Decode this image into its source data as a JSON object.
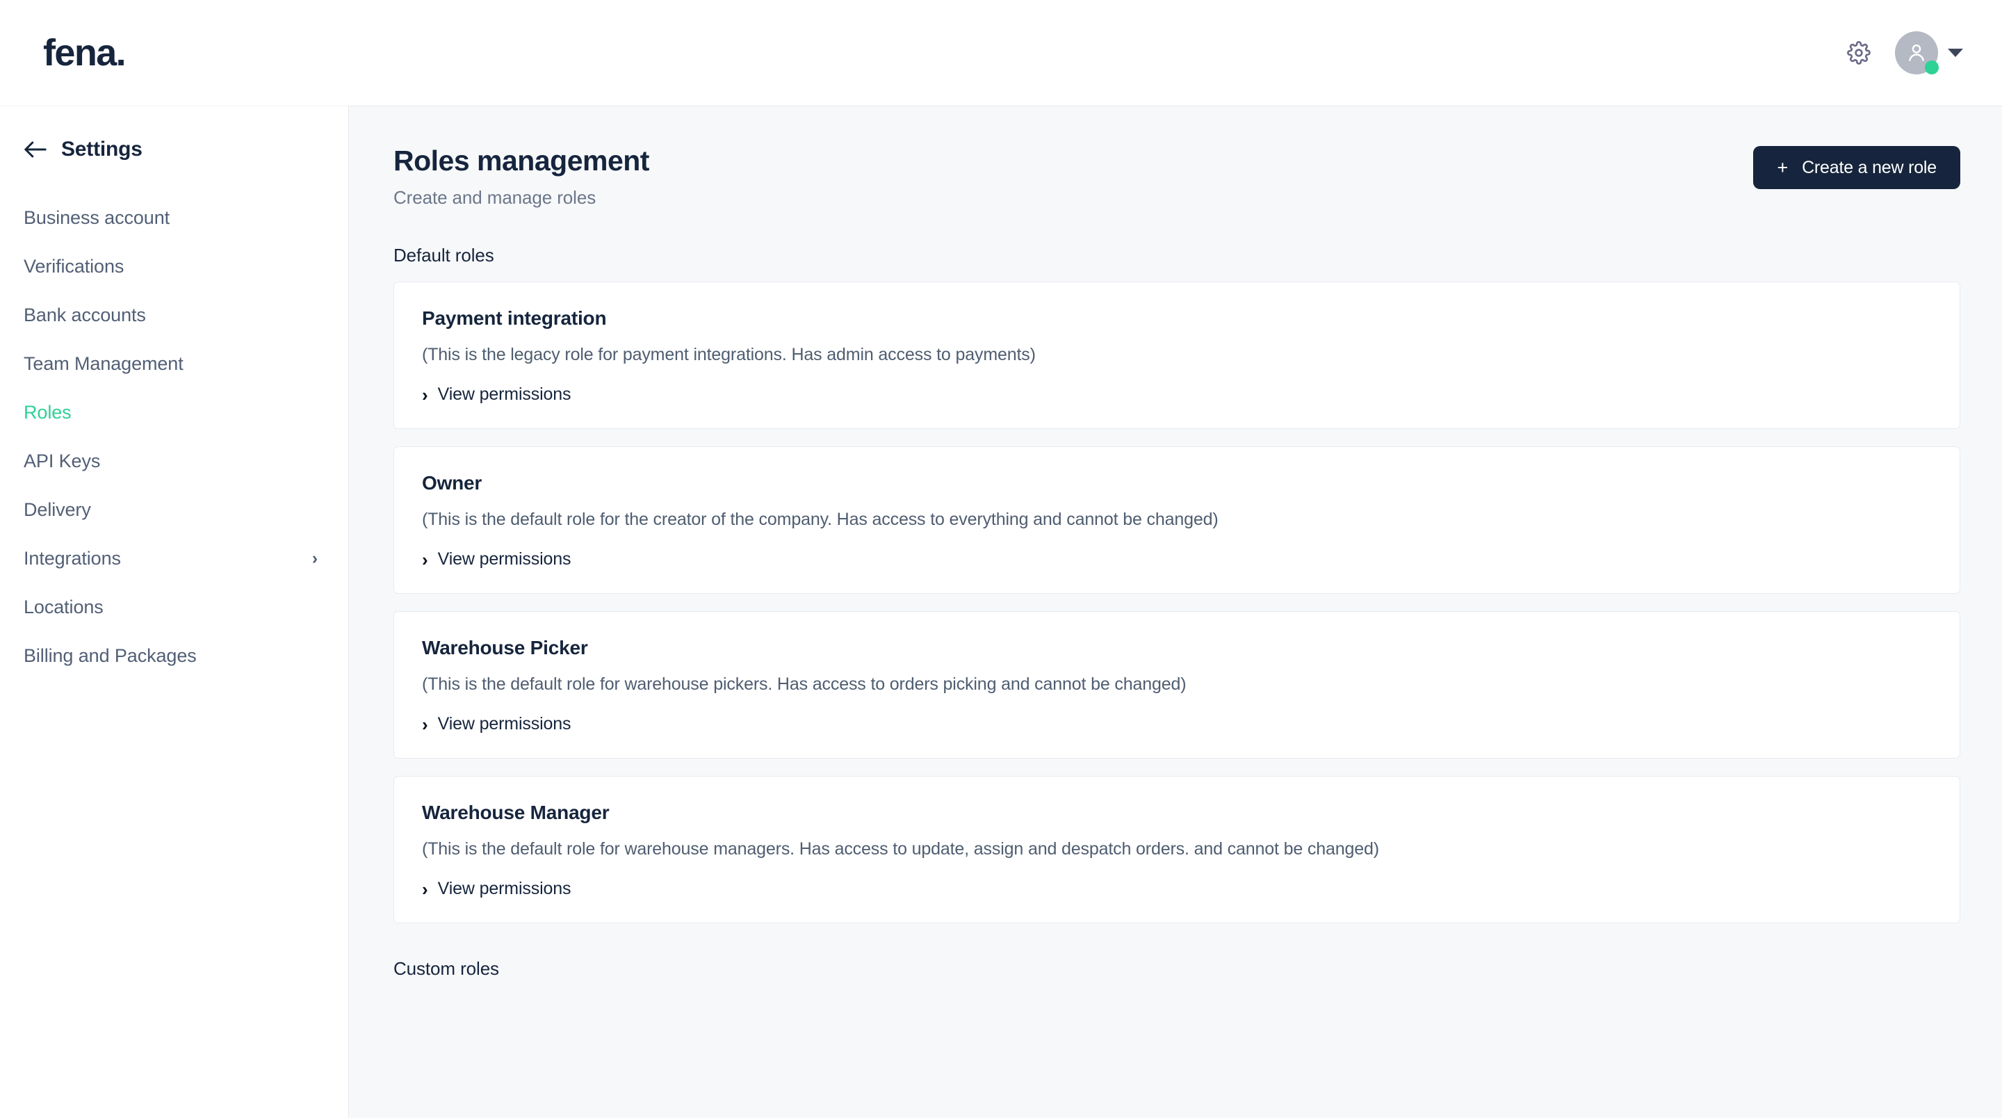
{
  "header": {
    "brand": "fena.",
    "gear_icon": "gear-icon",
    "avatar_icon": "person-icon",
    "status_color": "#2ed196",
    "caret_icon": "chevron-down-icon"
  },
  "sidebar": {
    "back_icon": "arrow-left-icon",
    "title": "Settings",
    "active_color": "#2ed196",
    "items": [
      {
        "label": "Business account",
        "active": false,
        "chevron": ""
      },
      {
        "label": "Verifications",
        "active": false,
        "chevron": ""
      },
      {
        "label": "Bank accounts",
        "active": false,
        "chevron": ""
      },
      {
        "label": "Team Management",
        "active": false,
        "chevron": ""
      },
      {
        "label": "Roles",
        "active": true,
        "chevron": ""
      },
      {
        "label": "API Keys",
        "active": false,
        "chevron": ""
      },
      {
        "label": "Delivery",
        "active": false,
        "chevron": ""
      },
      {
        "label": "Integrations",
        "active": false,
        "chevron": "›"
      },
      {
        "label": "Locations",
        "active": false,
        "chevron": ""
      },
      {
        "label": "Billing and Packages",
        "active": false,
        "chevron": ""
      }
    ]
  },
  "main": {
    "title": "Roles management",
    "subtitle": "Create and manage roles",
    "create_button": {
      "plus": "+",
      "label": "Create a new role",
      "color": "#16253d"
    },
    "default_roles_label": "Default roles",
    "custom_roles_label": "Custom roles",
    "view_permissions_label": "View permissions",
    "view_permissions_chevron": "›",
    "roles": [
      {
        "name": "Payment integration",
        "description": "(This is the legacy role for payment integrations. Has admin access to payments)"
      },
      {
        "name": "Owner",
        "description": "(This is the default role for the creator of the company. Has access to everything and cannot be changed)"
      },
      {
        "name": "Warehouse Picker",
        "description": "(This is the default role for warehouse pickers. Has access to orders picking and cannot be changed)"
      },
      {
        "name": "Warehouse Manager",
        "description": "(This is the default role for warehouse managers. Has access to update, assign and despatch orders. and cannot be changed)"
      }
    ]
  }
}
